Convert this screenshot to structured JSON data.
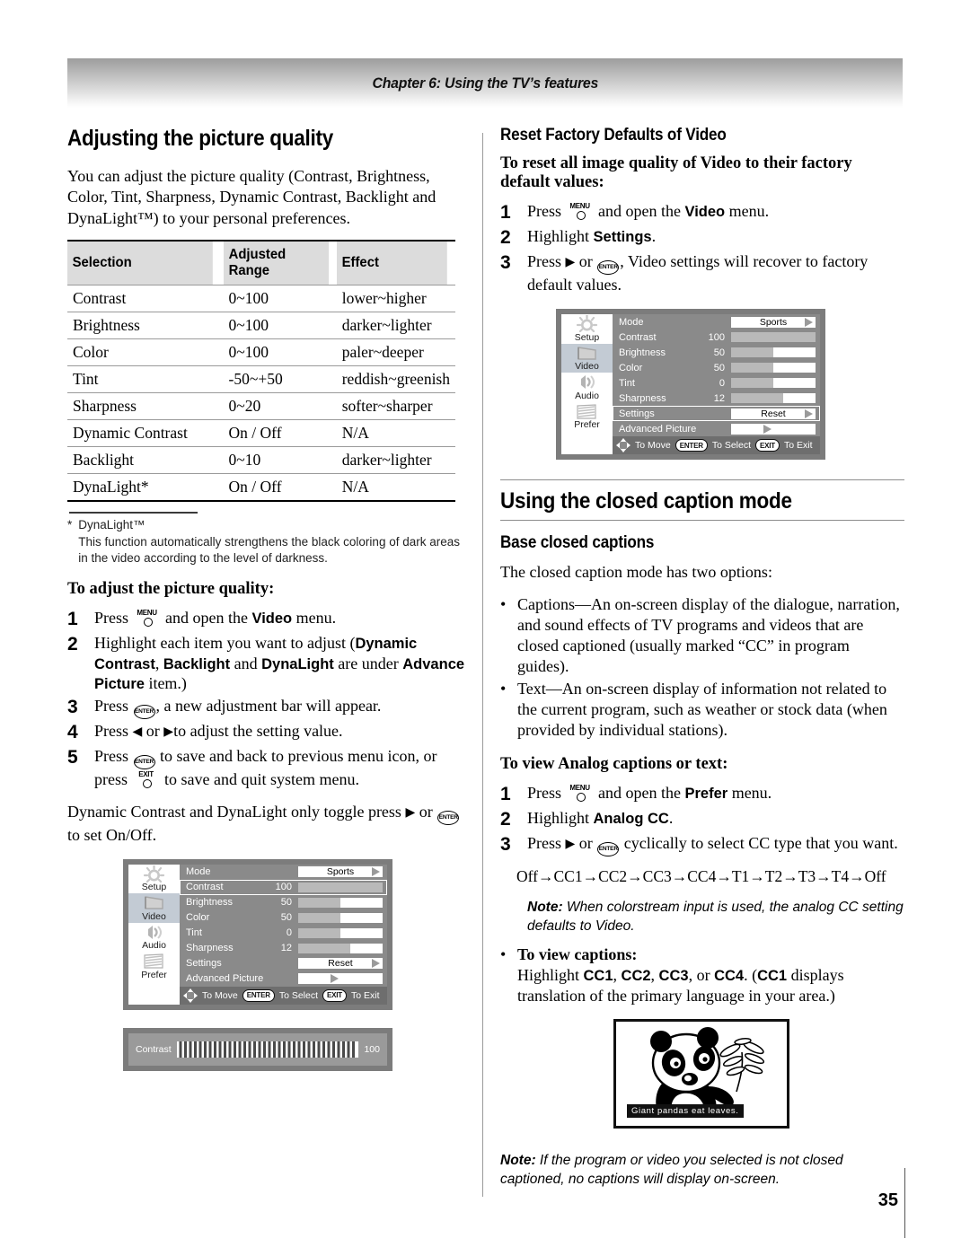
{
  "header": {
    "chapter": "Chapter 6: Using the TV’s features"
  },
  "page": {
    "number": "35"
  },
  "left": {
    "title": "Adjusting the picture quality",
    "intro": "You can adjust the picture quality (Contrast, Brightness, Color, Tint, Sharpness, Dynamic Contrast, Backlight and DynaLight™) to your personal preferences.",
    "table": {
      "headers": [
        "Selection",
        "Adjusted Range",
        "Effect"
      ],
      "rows": [
        [
          "Contrast",
          "0~100",
          "lower~higher"
        ],
        [
          "Brightness",
          "0~100",
          "darker~lighter"
        ],
        [
          "Color",
          "0~100",
          "paler~deeper"
        ],
        [
          "Tint",
          "-50~+50",
          "reddish~greenish"
        ],
        [
          "Sharpness",
          "0~20",
          "softer~sharper"
        ],
        [
          "Dynamic Contrast",
          "On / Off",
          "N/A"
        ],
        [
          "Backlight",
          "0~10",
          "darker~lighter"
        ],
        [
          "DynaLight*",
          "On / Off",
          "N/A"
        ]
      ]
    },
    "footnote": {
      "marker": "*",
      "term": "DynaLight™",
      "text": "This function automatically strengthens the black coloring of dark areas in the video according to the level of darkness."
    },
    "procedure_title": "To adjust the picture quality:",
    "steps": [
      {
        "num": "1",
        "parts": [
          "Press ",
          "MENU_KEY",
          " and open the ",
          "Video",
          " menu."
        ]
      },
      {
        "num": "2",
        "parts": [
          "Highlight each item you want to adjust (",
          "Dynamic Contrast",
          ", ",
          "Backlight",
          " and ",
          "DynaLight",
          " are under ",
          "Advance Picture",
          " item.)"
        ]
      },
      {
        "num": "3",
        "parts": [
          "Press ",
          "ENTER_KEY",
          ", a new adjustment bar will appear."
        ]
      },
      {
        "num": "4",
        "parts": [
          "Press ",
          "LEFT_TRI",
          " or ",
          "RIGHT_TRI",
          "to adjust the setting value."
        ]
      },
      {
        "num": "5",
        "parts": [
          "Press ",
          "ENTER_KEY",
          " to save and back to previous menu icon, or press ",
          "EXIT_KEY",
          " to save and quit system menu."
        ]
      }
    ],
    "step_text": {
      "s1a": "Press ",
      "s1b": " and open the ",
      "s1bold": "Video",
      "s1c": " menu.",
      "s2a": "Highlight each item you want to adjust (",
      "s2b1": "Dynamic Contrast",
      "s2b2": "Backlight",
      "s2b3": "DynaLight",
      "s2b4": "Advance Picture",
      "s2c": ", ",
      "s2d": " and ",
      "s2e": " are under ",
      "s2f": " item.)",
      "s3a": "Press ",
      "s3b": ", a new adjustment bar will appear.",
      "s4a": "Press ",
      "s4b": " or ",
      "s4c": "to adjust the setting value.",
      "s5a": "Press ",
      "s5b": " to save and back to previous menu icon, or press ",
      "s5c": " to save and quit system menu."
    },
    "closing_a": "Dynamic Contrast and DynaLight only toggle press ",
    "closing_b": " or ",
    "closing_c": " to set On/Off."
  },
  "right": {
    "reset_title": "Reset Factory Defaults of Video",
    "reset_lead": "To reset all image quality of Video to their factory default values:",
    "reset_steps": {
      "s1a": "Press ",
      "s1b": " and open the ",
      "s1bold": "Video",
      "s1c": " menu.",
      "s2a": "Highlight ",
      "s2bold": "Settings",
      "s2b": ".",
      "s3a": "Press ",
      "s3b": " or ",
      "s3c": ", Video settings will recover to factory default values."
    },
    "cc_title": "Using the closed caption mode",
    "cc_sub": "Base closed captions",
    "cc_lead": "The closed caption mode has two options:",
    "cc_bullets": [
      "Captions—An on-screen display of the dialogue, narration, and sound effects of TV programs and videos that are closed captioned (usually marked “CC” in program guides).",
      "Text—An on-screen display of information not related to the current program, such as weather or stock data (when provided by individual stations)."
    ],
    "analog_title": "To view Analog captions or text:",
    "analog_steps": {
      "s1a": "Press ",
      "s1b": " and open the ",
      "s1bold": "Prefer",
      "s1c": " menu.",
      "s2a": "Highlight ",
      "s2bold": "Analog CC",
      "s2b": ".",
      "s3a": "Press ",
      "s3b": " or ",
      "s3c": " cyclically to select CC type that you want."
    },
    "cc_flow": "Off→CC1→CC2→CC3→CC4→T1→T2→T3→T4→Off",
    "note1_label": "Note:",
    "note1_text": " When colorstream input is used, the analog CC setting defaults to Video.",
    "view_captions_title": "To view captions:",
    "view_captions_a": "Highlight ",
    "view_captions_b1": "CC1",
    "view_captions_b2": "CC2",
    "view_captions_b3": "CC3",
    "view_captions_b4": "CC4",
    "view_captions_c": ". (",
    "view_captions_b5": "CC1",
    "view_captions_d": " displays translation of the primary language in your area.)",
    "note2_label": "Note:",
    "note2_text": " If the program or video you selected is not closed captioned, no captions will display on-screen."
  },
  "osd": {
    "sidebar": [
      {
        "label": "Setup",
        "icon": "sun-icon",
        "selected": false
      },
      {
        "label": "Video",
        "icon": "tv-icon",
        "selected": true
      },
      {
        "label": "Audio",
        "icon": "speaker-icon",
        "selected": false
      },
      {
        "label": "Prefer",
        "icon": "list-icon",
        "selected": false
      }
    ],
    "footer": {
      "move": "To Move",
      "enter": "ENTER",
      "select": "To Select",
      "exit": "EXIT",
      "exit_label": "To Exit"
    },
    "menu_left": {
      "rows": [
        {
          "name": "Mode",
          "value": "",
          "type": "combo",
          "combo_text": "Sports",
          "fill": 0,
          "selected": false
        },
        {
          "name": "Contrast",
          "value": "100",
          "type": "bar",
          "fill": 100,
          "selected": true
        },
        {
          "name": "Brightness",
          "value": "50",
          "type": "bar",
          "fill": 50,
          "selected": false
        },
        {
          "name": "Color",
          "value": "50",
          "type": "bar",
          "fill": 50,
          "selected": false
        },
        {
          "name": "Tint",
          "value": "0",
          "type": "bar",
          "fill": 50,
          "selected": false
        },
        {
          "name": "Sharpness",
          "value": "12",
          "type": "bar",
          "fill": 62,
          "selected": false
        },
        {
          "name": "Settings",
          "value": "",
          "type": "combo",
          "combo_text": "Reset",
          "fill": 0,
          "selected": false
        },
        {
          "name": "Advanced Picture",
          "value": "",
          "type": "arrow",
          "combo_text": "",
          "fill": 0,
          "selected": false
        }
      ]
    },
    "menu_right": {
      "rows": [
        {
          "name": "Mode",
          "value": "",
          "type": "combo",
          "combo_text": "Sports",
          "fill": 0,
          "selected": false
        },
        {
          "name": "Contrast",
          "value": "100",
          "type": "bar",
          "fill": 100,
          "selected": false
        },
        {
          "name": "Brightness",
          "value": "50",
          "type": "bar",
          "fill": 50,
          "selected": false
        },
        {
          "name": "Color",
          "value": "50",
          "type": "bar",
          "fill": 50,
          "selected": false
        },
        {
          "name": "Tint",
          "value": "0",
          "type": "bar",
          "fill": 50,
          "selected": false
        },
        {
          "name": "Sharpness",
          "value": "12",
          "type": "bar",
          "fill": 62,
          "selected": false
        },
        {
          "name": "Settings",
          "value": "",
          "type": "combo",
          "combo_text": "Reset",
          "fill": 0,
          "selected": true
        },
        {
          "name": "Advanced Picture",
          "value": "",
          "type": "arrow",
          "combo_text": "",
          "fill": 0,
          "selected": false
        }
      ]
    }
  },
  "contrast_bar": {
    "label": "Contrast",
    "value": "100"
  },
  "panda": {
    "caption": "Giant  pandas  eat  leaves."
  },
  "colors": {
    "osd_bg": "#7c7c7c",
    "osd_panel": "#8a8a8a",
    "osd_footer": "#6e6e6e",
    "osd_selected_side": "#c3cbd4",
    "bar_fill": "#b9b9b9",
    "table_header": "#dcdcdc"
  }
}
